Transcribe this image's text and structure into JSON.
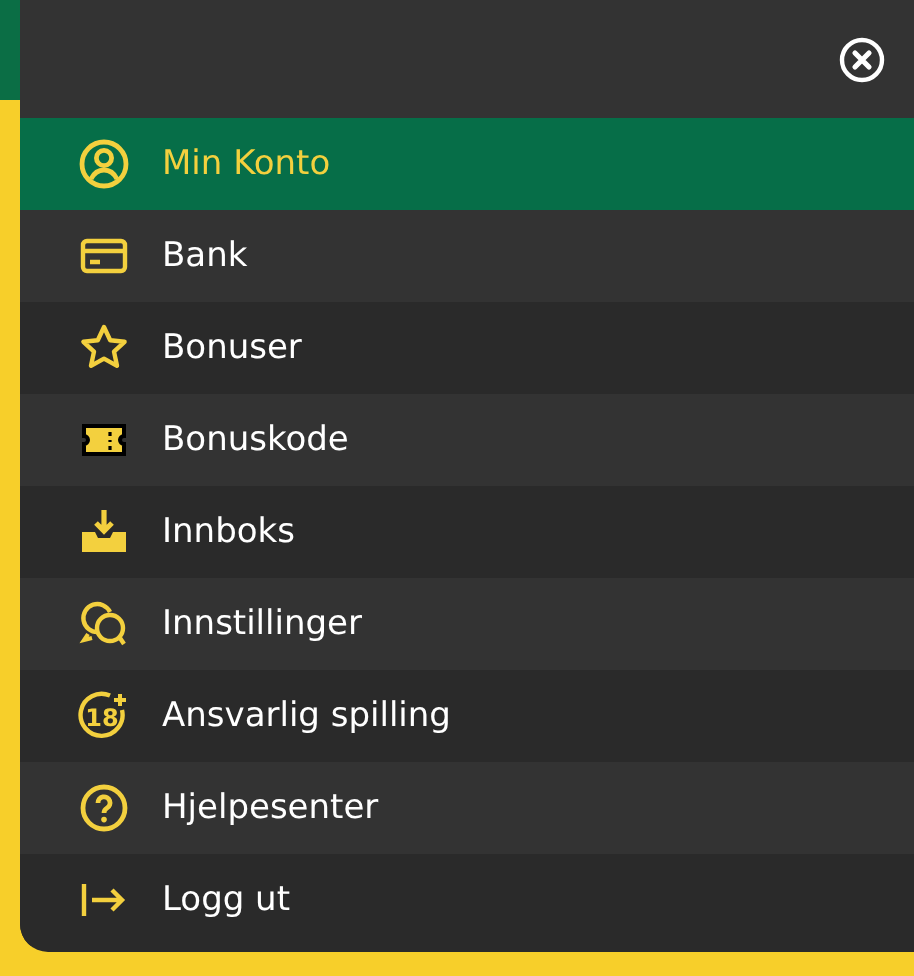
{
  "menu": {
    "items": [
      {
        "label": "Min Konto",
        "kind": "user",
        "selected": true
      },
      {
        "label": "Bank",
        "kind": "card",
        "selected": false
      },
      {
        "label": "Bonuser",
        "kind": "star",
        "selected": false
      },
      {
        "label": "Bonuskode",
        "kind": "ticket",
        "selected": false
      },
      {
        "label": "Innboks",
        "kind": "inbox",
        "selected": false
      },
      {
        "label": "Innstillinger",
        "kind": "chat",
        "selected": false
      },
      {
        "label": "Ansvarlig spilling",
        "kind": "age",
        "icon_text": "18",
        "selected": false
      },
      {
        "label": "Hjelpesenter",
        "kind": "help",
        "selected": false
      },
      {
        "label": "Logg ut",
        "kind": "logout",
        "selected": false
      }
    ]
  }
}
